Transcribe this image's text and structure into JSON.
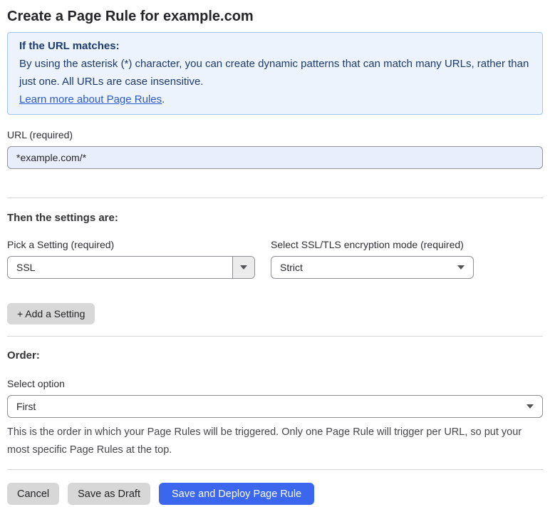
{
  "page": {
    "title": "Create a Page Rule for example.com"
  },
  "info_box": {
    "heading": "If the URL matches:",
    "body": "By using the asterisk (*) character, you can create dynamic patterns that can match many URLs, rather than just one. All URLs are case insensitive.",
    "link": "Learn more about Page Rules",
    "link_suffix": "."
  },
  "url_field": {
    "label": "URL (required)",
    "value": "*example.com/*"
  },
  "settings_section": {
    "heading": "Then the settings are:",
    "setting_picker": {
      "label": "Pick a Setting (required)",
      "value": "SSL"
    },
    "mode_select": {
      "label": "Select SSL/TLS encryption mode (required)",
      "value": "Strict"
    },
    "add_setting_button": "+ Add a Setting"
  },
  "order_section": {
    "heading": "Order:",
    "select_label": "Select option",
    "value": "First",
    "help_text": "This is the order in which your Page Rules will be triggered. Only one Page Rule will trigger per URL, so put your most specific Page Rules at the top."
  },
  "actions": {
    "cancel": "Cancel",
    "save_draft": "Save as Draft",
    "save_deploy": "Save and Deploy Page Rule"
  },
  "colors": {
    "info_background": "#ecf3fc",
    "info_border": "#a3c6ed",
    "info_text": "#1d3a6e",
    "link": "#2b5bc7",
    "url_input_background": "#e8eefb",
    "primary_button": "#3b67ee",
    "gray_button": "#d7d7d7",
    "divider": "#d5d5d5"
  }
}
